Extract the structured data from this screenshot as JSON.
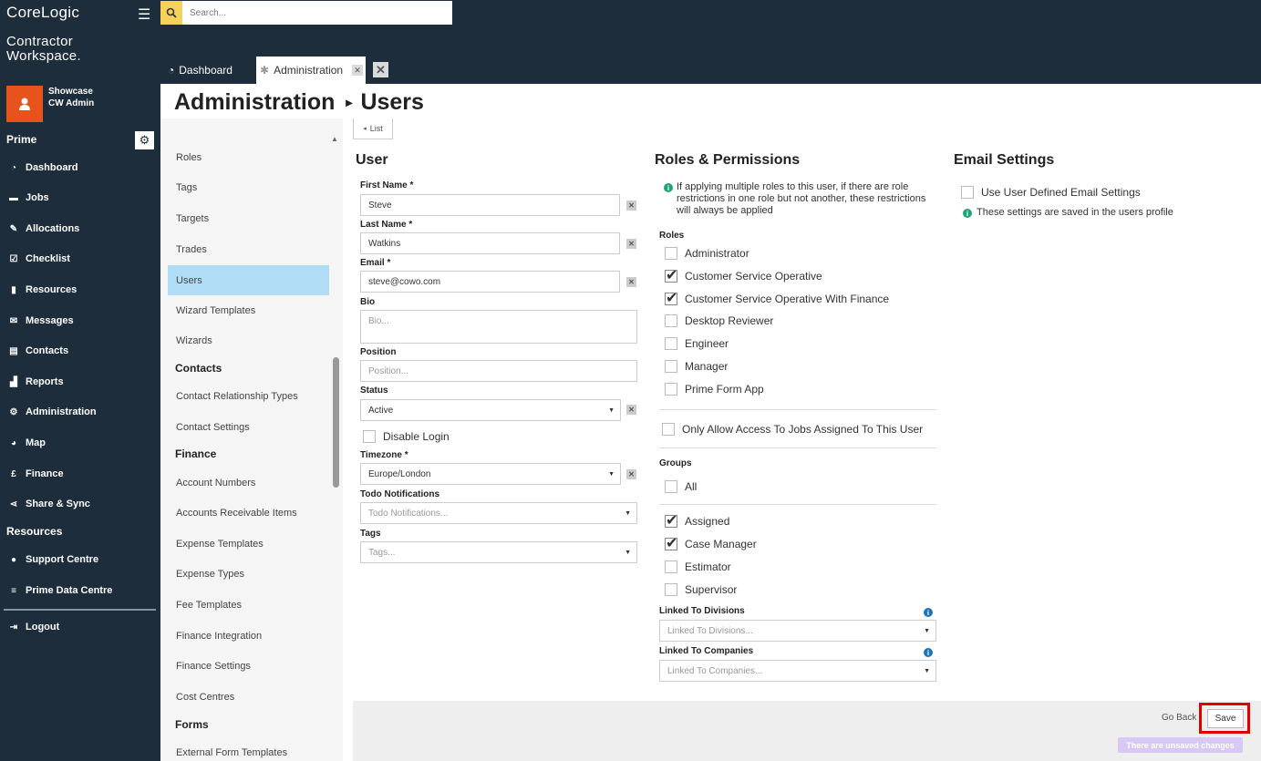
{
  "app": {
    "brand": "CoreLogic",
    "product_line1": "Contractor",
    "product_line2": "Workspace."
  },
  "user": {
    "org": "Showcase",
    "role": "CW Admin"
  },
  "leftnav": {
    "section_prime": "Prime",
    "section_resources": "Resources",
    "items": [
      {
        "label": "Dashboard",
        "icon": "gauge-icon"
      },
      {
        "label": "Jobs",
        "icon": "folder-icon"
      },
      {
        "label": "Allocations",
        "icon": "wrench-icon"
      },
      {
        "label": "Checklist",
        "icon": "checkbox-icon"
      },
      {
        "label": "Resources",
        "icon": "clipboard-icon"
      },
      {
        "label": "Messages",
        "icon": "envelope-icon"
      },
      {
        "label": "Contacts",
        "icon": "address-book-icon"
      },
      {
        "label": "Reports",
        "icon": "bar-chart-icon"
      },
      {
        "label": "Administration",
        "icon": "gear-icon"
      },
      {
        "label": "Map",
        "icon": "globe-icon"
      },
      {
        "label": "Finance",
        "icon": "pound-icon"
      },
      {
        "label": "Share & Sync",
        "icon": "share-icon"
      }
    ],
    "resource_items": [
      {
        "label": "Support Centre",
        "icon": "info-icon"
      },
      {
        "label": "Prime Data Centre",
        "icon": "database-icon"
      }
    ],
    "logout": "Logout"
  },
  "search": {
    "placeholder": "Search..."
  },
  "tabs": {
    "dashboard": "Dashboard",
    "administration": "Administration"
  },
  "page": {
    "title": "Administration",
    "subtitle": "Users"
  },
  "subnav": {
    "items_top": [
      "Roles",
      "Tags",
      "Targets",
      "Trades",
      "Users",
      "Wizard Templates",
      "Wizards"
    ],
    "head_contacts": "Contacts",
    "contacts_items": [
      "Contact Relationship Types",
      "Contact Settings"
    ],
    "head_finance": "Finance",
    "finance_items": [
      "Account Numbers",
      "Accounts Receivable Items",
      "Expense Templates",
      "Expense Types",
      "Fee Templates",
      "Finance Integration",
      "Finance Settings",
      "Cost Centres"
    ],
    "head_forms": "Forms",
    "forms_items": [
      "External Form Templates"
    ]
  },
  "list_button": "List",
  "user_form": {
    "title": "User",
    "first_name_label": "First Name *",
    "first_name": "Steve",
    "last_name_label": "Last Name *",
    "last_name": "Watkins",
    "email_label": "Email *",
    "email": "steve@cowo.com",
    "bio_label": "Bio",
    "bio_placeholder": "Bio...",
    "position_label": "Position",
    "position_placeholder": "Position...",
    "status_label": "Status",
    "status": "Active",
    "disable_login": "Disable Login",
    "timezone_label": "Timezone *",
    "timezone": "Europe/London",
    "todo_label": "Todo Notifications",
    "todo_placeholder": "Todo Notifications...",
    "tags_label": "Tags",
    "tags_placeholder": "Tags..."
  },
  "roles": {
    "title": "Roles & Permissions",
    "info": "If applying multiple roles to this user, if there are role restrictions in one role but not another, these restrictions will always be applied",
    "roles_label": "Roles",
    "roles_list": [
      {
        "label": "Administrator",
        "checked": false
      },
      {
        "label": "Customer Service Operative",
        "checked": true
      },
      {
        "label": "Customer Service Operative With Finance",
        "checked": true
      },
      {
        "label": "Desktop Reviewer",
        "checked": false
      },
      {
        "label": "Engineer",
        "checked": false
      },
      {
        "label": "Manager",
        "checked": false
      },
      {
        "label": "Prime Form App",
        "checked": false
      }
    ],
    "only_assigned": "Only Allow Access To Jobs Assigned To This User",
    "groups_label": "Groups",
    "group_all": "All",
    "groups": [
      {
        "label": "Assigned",
        "checked": true
      },
      {
        "label": "Case Manager",
        "checked": true
      },
      {
        "label": "Estimator",
        "checked": false
      },
      {
        "label": "Supervisor",
        "checked": false
      }
    ],
    "divisions_label": "Linked To Divisions",
    "divisions_placeholder": "Linked To Divisions...",
    "companies_label": "Linked To Companies",
    "companies_placeholder": "Linked To Companies..."
  },
  "email_settings": {
    "title": "Email Settings",
    "use_defined": "Use User Defined Email Settings",
    "info": "These settings are saved in the users profile"
  },
  "footer": {
    "go_back": "Go Back",
    "save": "Save",
    "unsaved": "There are unsaved changes"
  },
  "colors": {
    "nav_bg": "#1e2d3b",
    "avatar": "#e8521b",
    "active_item": "#b1dcf6",
    "search_button": "#f6d25b",
    "highlight": "#e00000"
  }
}
